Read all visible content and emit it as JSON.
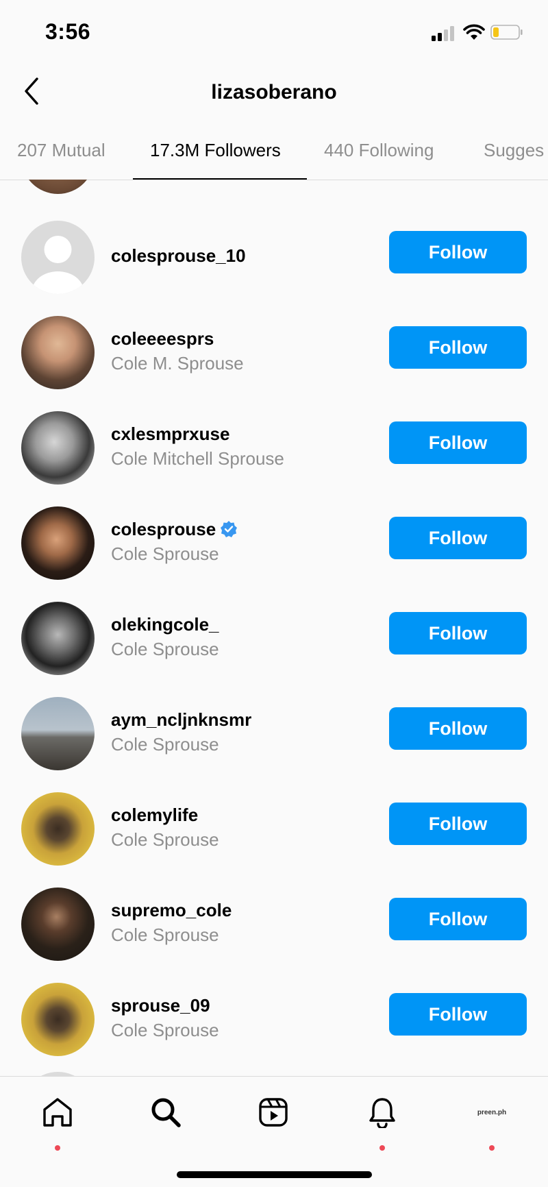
{
  "status_bar": {
    "time": "3:56",
    "battery_color": "#f5c518"
  },
  "header": {
    "title": "lizasoberano",
    "back_icon": "chevron-left-icon"
  },
  "tabs": [
    {
      "label": "207 Mutual",
      "active": false
    },
    {
      "label": "17.3M Followers",
      "active": true
    },
    {
      "label": "440 Following",
      "active": false
    },
    {
      "label": "Sugges",
      "active": false
    }
  ],
  "follow_button_color": "#0095f6",
  "rows": [
    {
      "username": "colesprouse_10",
      "fullname": "",
      "verified": false,
      "follow_label": "Follow",
      "avatar": "default-avatar"
    },
    {
      "username": "coleeeesprs",
      "fullname": "Cole M. Sprouse",
      "verified": false,
      "follow_label": "Follow",
      "avatar": "photo-avatar"
    },
    {
      "username": "cxlesmprxuse",
      "fullname": "Cole Mitchell Sprouse",
      "verified": false,
      "follow_label": "Follow",
      "avatar": "photo-avatar"
    },
    {
      "username": "colesprouse",
      "fullname": "Cole Sprouse",
      "verified": true,
      "follow_label": "Follow",
      "avatar": "photo-avatar"
    },
    {
      "username": "olekingcole_",
      "fullname": "Cole Sprouse",
      "verified": false,
      "follow_label": "Follow",
      "avatar": "photo-avatar"
    },
    {
      "username": "aym_ncljnknsmr",
      "fullname": "Cole Sprouse",
      "verified": false,
      "follow_label": "Follow",
      "avatar": "photo-avatar"
    },
    {
      "username": "colemylife",
      "fullname": "Cole Sprouse",
      "verified": false,
      "follow_label": "Follow",
      "avatar": "photo-avatar"
    },
    {
      "username": "supremo_cole",
      "fullname": "Cole Sprouse",
      "verified": false,
      "follow_label": "Follow",
      "avatar": "photo-avatar"
    },
    {
      "username": "sprouse_09",
      "fullname": "Cole Sprouse",
      "verified": false,
      "follow_label": "Follow",
      "avatar": "photo-avatar"
    }
  ],
  "bottom_nav": {
    "items": [
      "home-icon",
      "search-icon",
      "reels-icon",
      "notifications-icon",
      "profile-avatar"
    ],
    "profile_logo_text": "preen.ph"
  }
}
